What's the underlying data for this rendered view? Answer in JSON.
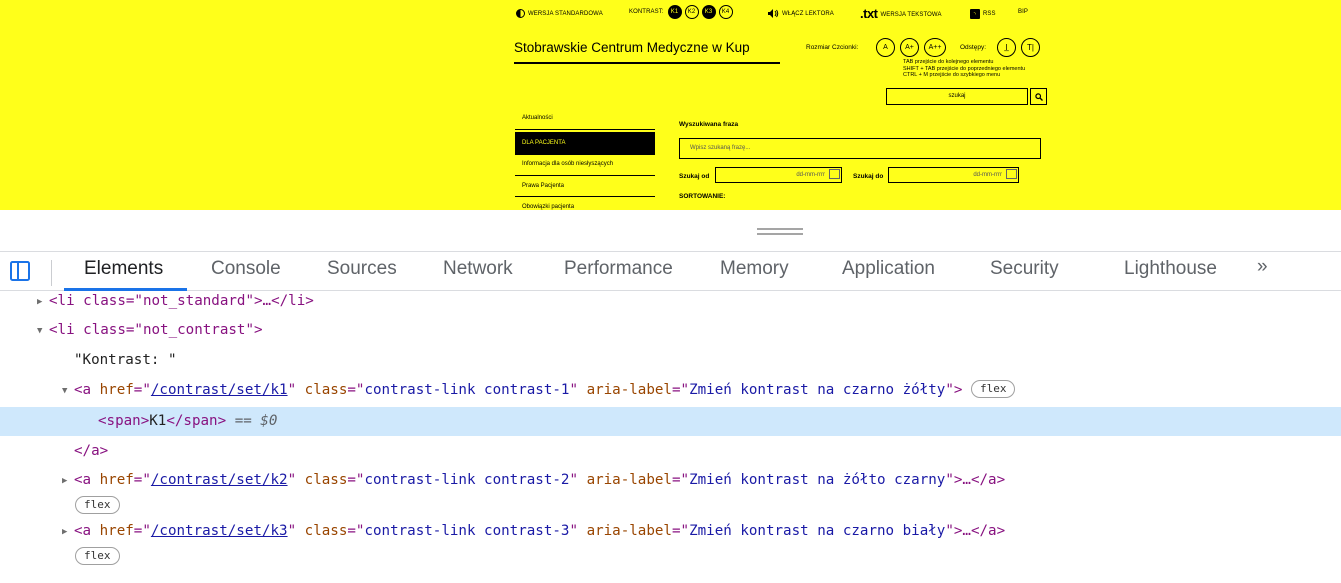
{
  "site": {
    "topbar": {
      "standard": "WERSJA STANDARDOWA",
      "kontrast": "KONTRAST:",
      "k1": "K1",
      "k2": "K2",
      "k3": "K3",
      "k4": "K4",
      "reader": "WŁĄCZ LEKTORA",
      "txt_logo": ".txt",
      "text_version": "WERSJA TEKSTOWA",
      "rss": "RSS",
      "bip": "BIP"
    },
    "title": "Stobrawskie Centrum Medyczne w Kup",
    "font_size_label": "Rozmiar Czcionki:",
    "font_a": "A",
    "font_a_plus": "A+",
    "font_a_plusplus": "A++",
    "spacing_label": "Odstępy:",
    "keyboard_help": [
      "TAB przejście do kolejnego elementu",
      "SHIFT + TAB przejście do poprzedniego elementu",
      "CTRL + M przejście do szybkiego menu"
    ],
    "search_placeholder": "szukaj",
    "menu": [
      "Aktualności",
      "DLA PACJENTA",
      "Informacja dla osób niesłyszących",
      "Prawa Pacjenta",
      "Obowiązki pacjenta"
    ],
    "search_form": {
      "phrase_label": "Wyszukiwana fraza",
      "phrase_placeholder": "Wpisz szukaną frazę...",
      "from_label": "Szukaj od",
      "to_label": "Szukaj do",
      "date_placeholder": "dd-mm-rrrr",
      "sort_label": "SORTOWANIE:"
    }
  },
  "devtools": {
    "tabs": [
      "Elements",
      "Console",
      "Sources",
      "Network",
      "Performance",
      "Memory",
      "Application",
      "Security",
      "Lighthouse"
    ],
    "active_tab": "Elements",
    "more_tabs": "»",
    "tree": {
      "li_standard_open": "<li class=\"not_standard\">",
      "li_standard_close": "…</li>",
      "li_contrast": "<li class=\"not_contrast\">",
      "text_node": "\"Kontrast: \"",
      "a1_href": "/contrast/set/k1",
      "a1_class": "contrast-link contrast-1",
      "a1_label": "Zmień kontrast na czarno żółty",
      "span": "K1",
      "selected_marker": "== $0",
      "a_close": "</a>",
      "a2_href": "/contrast/set/k2",
      "a2_class": "contrast-link contrast-2",
      "a2_label": "Zmień kontrast na żółto czarny",
      "a3_href": "/contrast/set/k3",
      "a3_class": "contrast-link contrast-3",
      "a3_label": "Zmień kontrast na czarno biały",
      "collapsed_tail": "…</a>",
      "badge": "flex"
    }
  },
  "colors": {
    "site_bg": "#ffff1a",
    "selected_row": "#cfe8fc",
    "tab_accent": "#1a73e8"
  }
}
